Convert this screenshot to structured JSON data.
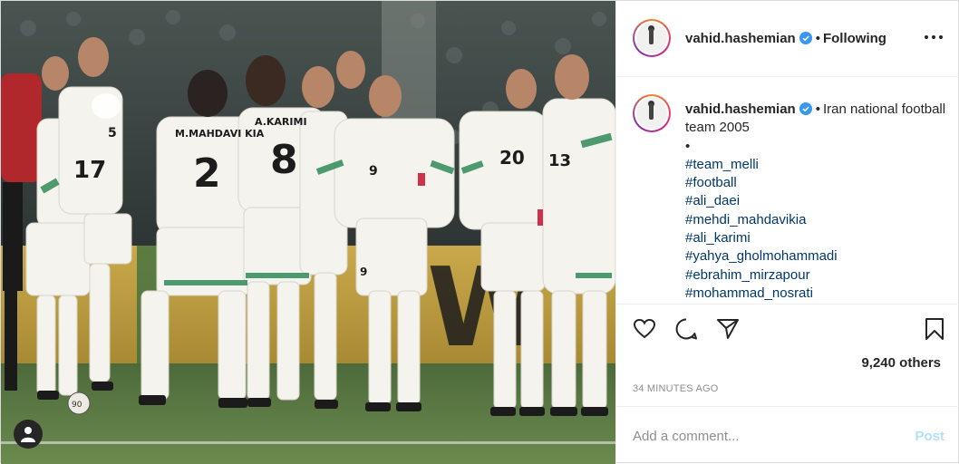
{
  "post": {
    "username": "vahid.hashemian",
    "follow_state": "Following",
    "caption_text": "Iran national football team 2005",
    "caption_bullet": "•",
    "hashtags": [
      "#team_melli",
      "#football",
      "#ali_daei",
      "#mehdi_mahdavikia",
      "#ali_karimi",
      "#yahya_gholmohammadi",
      "#ebrahim_mirzapour",
      "#mohammad_nosrati"
    ],
    "likes": "9,240 others",
    "timestamp": "34 MINUTES AGO",
    "comment_placeholder": "Add a comment...",
    "post_label": "Post"
  },
  "photo": {
    "jersey_names": [
      "M.MAHDAVI KIA",
      "A.KARIMI"
    ],
    "jersey_numbers": [
      "2",
      "8",
      "9",
      "20",
      "17",
      "5",
      "13"
    ],
    "shorts_number": "9",
    "ball_number": "90"
  },
  "colors": {
    "verified_badge": "#3897f0",
    "link": "#00376b",
    "post_disabled": "#b2dffc",
    "kit_white": "#f4f3ee",
    "kit_green": "#2e8b57",
    "kit_red": "#c8102e"
  }
}
